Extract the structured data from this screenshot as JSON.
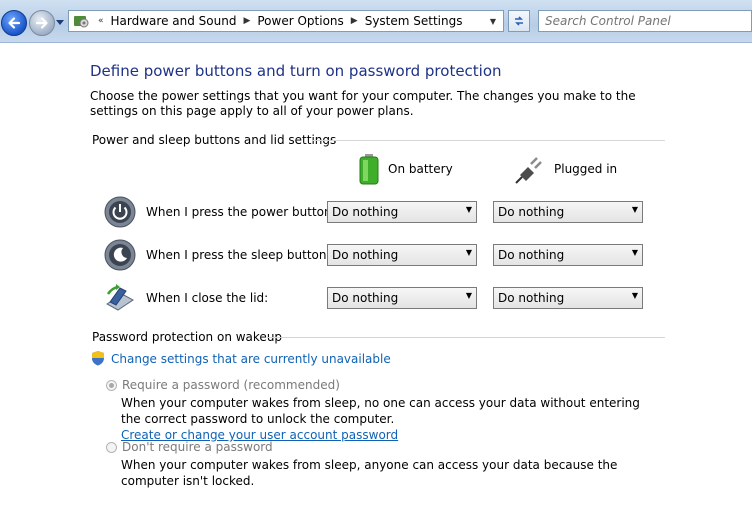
{
  "nav": {
    "breadcrumbs": [
      "Hardware and Sound",
      "Power Options",
      "System Settings"
    ],
    "search_placeholder": "Search Control Panel"
  },
  "page": {
    "title": "Define power buttons and turn on password protection",
    "intro": "Choose the power settings that you want for your computer. The changes you make to the settings on this page apply to all of your power plans."
  },
  "buttons_section": {
    "header": "Power and sleep buttons and lid settings",
    "col_battery": "On battery",
    "col_plugged": "Plugged in",
    "rows": [
      {
        "label": "When I press the power button:",
        "battery": "Do nothing",
        "plugged": "Do nothing"
      },
      {
        "label": "When I press the sleep button:",
        "battery": "Do nothing",
        "plugged": "Do nothing"
      },
      {
        "label": "When I close the lid:",
        "battery": "Do nothing",
        "plugged": "Do nothing"
      }
    ]
  },
  "password_section": {
    "header": "Password protection on wakeup",
    "change_link": "Change settings that are currently unavailable",
    "require_label": "Require a password (recommended)",
    "require_desc": "When your computer wakes from sleep, no one can access your data without entering the correct password to unlock the computer.",
    "account_link": "Create or change your user account password",
    "norequire_label": "Don't require a password",
    "norequire_desc": "When your computer wakes from sleep, anyone can access your data because the computer isn't locked.",
    "require_checked": true
  },
  "colors": {
    "title": "#1e3287",
    "link": "#0f62b5",
    "disabled_text": "#7a7a7a"
  },
  "icons": [
    "back-arrow-icon",
    "forward-arrow-icon",
    "control-panel-icon",
    "refresh-icon",
    "battery-icon",
    "plug-icon",
    "power-button-icon",
    "sleep-button-icon",
    "laptop-lid-icon",
    "uac-shield-icon"
  ]
}
